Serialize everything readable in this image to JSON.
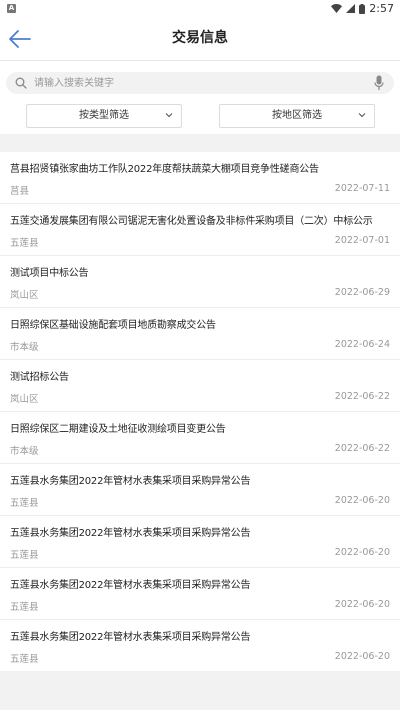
{
  "status_bar": {
    "app_badge": "A",
    "time": "2:57"
  },
  "header": {
    "title": "交易信息",
    "back_icon": "back-arrow-icon"
  },
  "search": {
    "placeholder": "请输入搜索关键字",
    "value": ""
  },
  "filters": {
    "type_label": "按类型筛选",
    "region_label": "按地区筛选"
  },
  "colors": {
    "accent": "#4a7fd4",
    "muted_text": "#999999",
    "background": "#f2f2f2"
  },
  "list": {
    "items": [
      {
        "title": "莒县招贤镇张家曲坊工作队2022年度帮扶蔬菜大棚项目竞争性磋商公告",
        "region": "莒县",
        "date": "2022-07-11"
      },
      {
        "title": "五莲交通发展集团有限公司锯泥无害化处置设备及非标件采购项目（二次）中标公示",
        "region": "五莲县",
        "date": "2022-07-01"
      },
      {
        "title": "测试项目中标公告",
        "region": "岚山区",
        "date": "2022-06-29"
      },
      {
        "title": "日照综保区基础设施配套项目地质勘察成交公告",
        "region": "市本级",
        "date": "2022-06-24"
      },
      {
        "title": "测试招标公告",
        "region": "岚山区",
        "date": "2022-06-22"
      },
      {
        "title": "日照综保区二期建设及土地征收测绘项目变更公告",
        "region": "市本级",
        "date": "2022-06-22"
      },
      {
        "title": "五莲县水务集团2022年管材水表集采项目采购异常公告",
        "region": "五莲县",
        "date": "2022-06-20"
      },
      {
        "title": "五莲县水务集团2022年管材水表集采项目采购异常公告",
        "region": "五莲县",
        "date": "2022-06-20"
      },
      {
        "title": "五莲县水务集团2022年管材水表集采项目采购异常公告",
        "region": "五莲县",
        "date": "2022-06-20"
      },
      {
        "title": "五莲县水务集团2022年管材水表集采项目采购异常公告",
        "region": "五莲县",
        "date": "2022-06-20"
      }
    ]
  }
}
